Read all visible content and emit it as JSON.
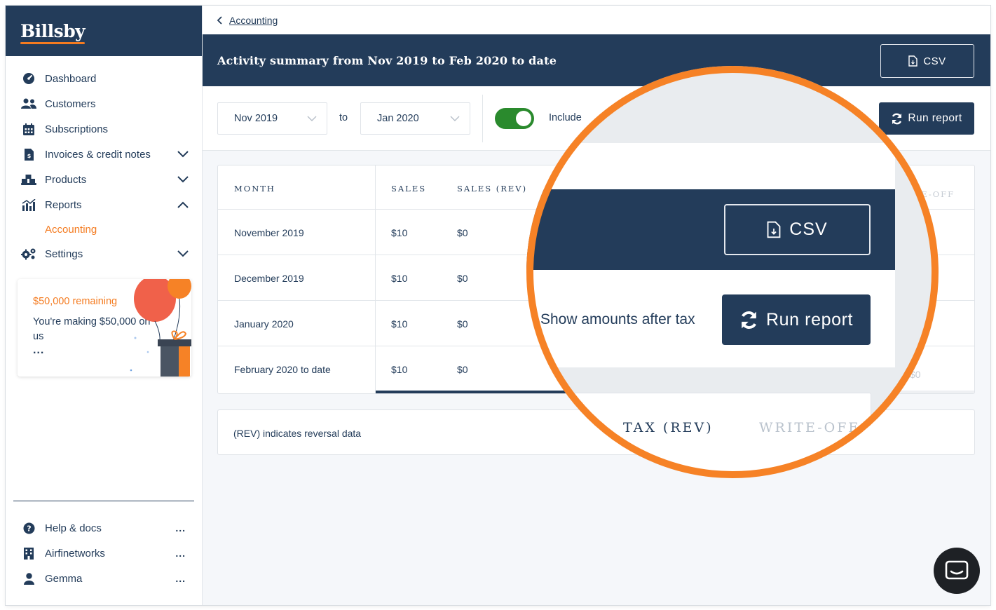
{
  "brand": {
    "logo_text": "Billsby"
  },
  "sidebar": {
    "items": [
      {
        "label": "Dashboard",
        "icon": "dashboard-icon"
      },
      {
        "label": "Customers",
        "icon": "users-icon"
      },
      {
        "label": "Subscriptions",
        "icon": "calendar-icon"
      },
      {
        "label": "Invoices & credit notes",
        "icon": "invoice-icon",
        "chevron": "down"
      },
      {
        "label": "Products",
        "icon": "boxes-icon",
        "chevron": "down"
      },
      {
        "label": "Reports",
        "icon": "chart-icon",
        "chevron": "up"
      },
      {
        "label": "Accounting",
        "sub": true
      },
      {
        "label": "Settings",
        "icon": "gears-icon",
        "chevron": "down"
      }
    ],
    "promo": {
      "amount": "$50,000 remaining",
      "text": "You're making $50,000 on us",
      "more": "..."
    },
    "bottom": [
      {
        "label": "Help & docs",
        "icon": "help-icon",
        "more": "..."
      },
      {
        "label": "Airfinetworks",
        "icon": "building-icon",
        "more": "..."
      },
      {
        "label": "Gemma",
        "icon": "user-icon",
        "more": "..."
      }
    ]
  },
  "breadcrumb": {
    "back_label": "Accounting"
  },
  "banner": {
    "title": "Activity summary from Nov 2019 to Feb 2020 to date",
    "csv_label": "CSV"
  },
  "filters": {
    "from": "Nov 2019",
    "to_label": "to",
    "to": "Jan 2020",
    "toggle_on": true,
    "toggle_label": "Include",
    "run_label": "Run report"
  },
  "table": {
    "headers": [
      "MONTH",
      "SALES",
      "SALES (REV)"
    ],
    "rows": [
      [
        "November 2019",
        "$10",
        "$0"
      ],
      [
        "December 2019",
        "$10",
        "$0"
      ],
      [
        "January 2020",
        "$10",
        "$0"
      ],
      [
        "February 2020 to date",
        "$10",
        "$0"
      ]
    ],
    "behind_header": "ITE-OFF",
    "behind_value": "$0"
  },
  "note": "(REV) indicates reversal data",
  "zoom": {
    "csv_label": "CSV",
    "show_label": "Show amounts after tax",
    "run_label": "Run report",
    "th1": "TAX (REV)",
    "th2": "WRITE-OFF"
  },
  "colors": {
    "navy": "#233c5a",
    "orange": "#f47b20",
    "ring": "#f68226",
    "toggle": "#2a8a2d"
  }
}
